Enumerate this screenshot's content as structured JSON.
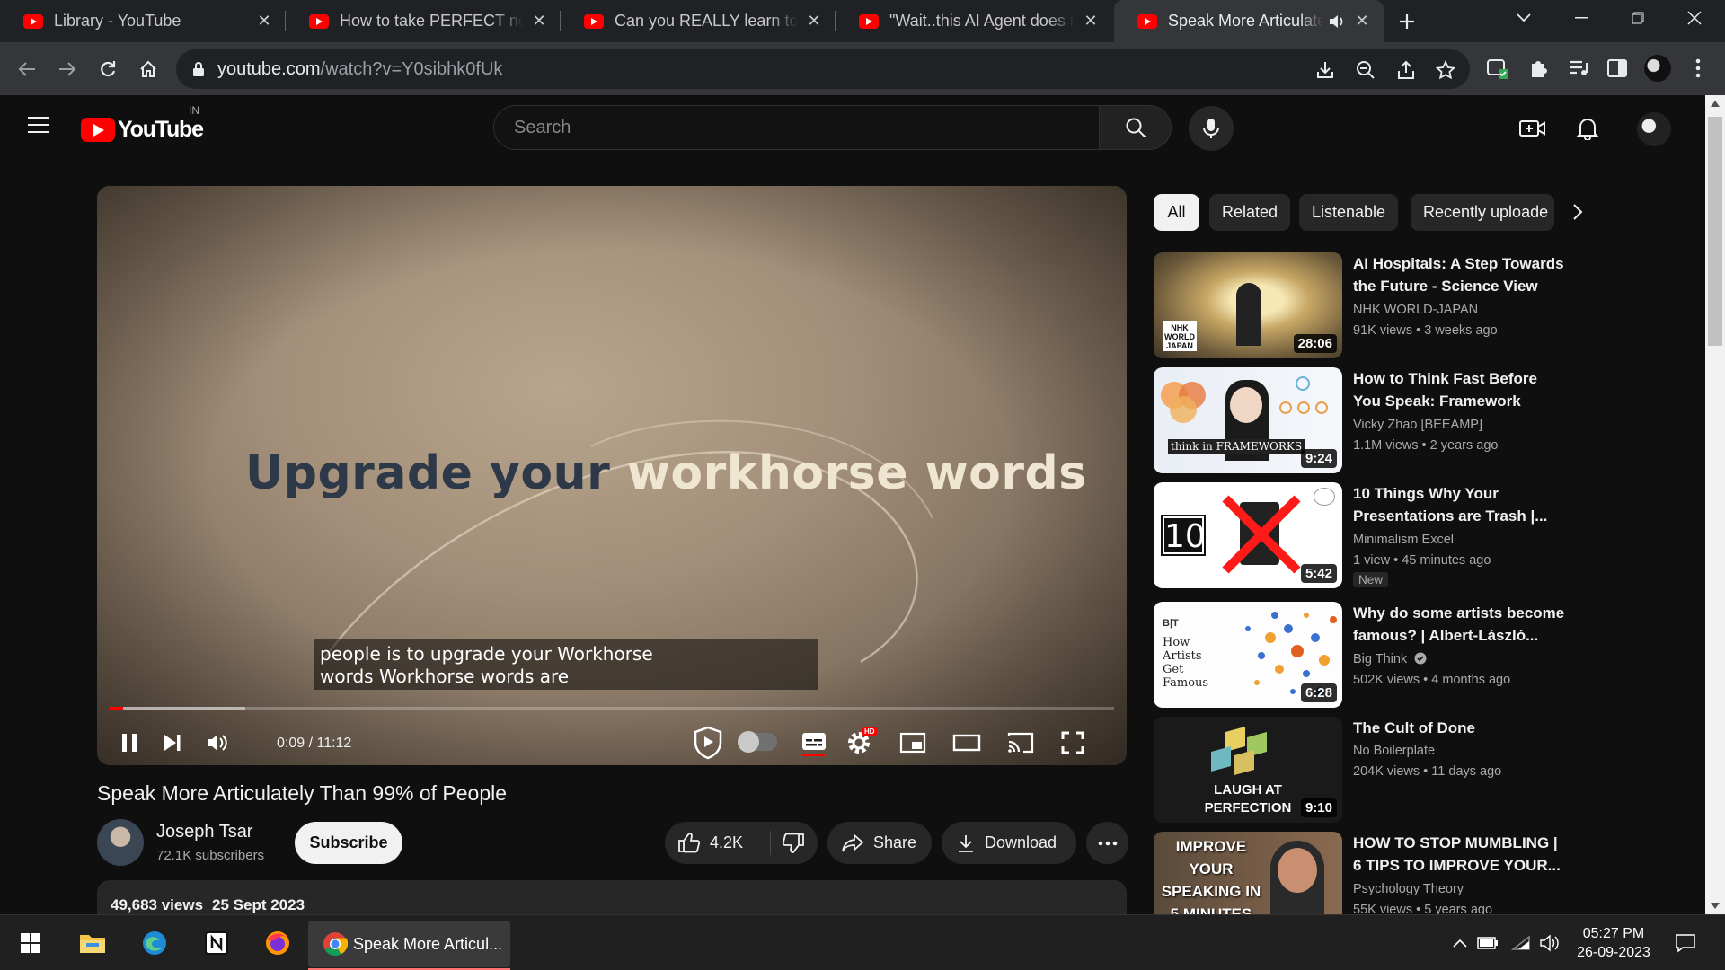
{
  "browser": {
    "tabs": [
      {
        "title": "Library - YouTube",
        "active": false
      },
      {
        "title": "How to take PERFECT notes w",
        "active": false
      },
      {
        "title": "Can you REALLY learn to code",
        "active": false
      },
      {
        "title": "\"Wait..this AI Agent does rese",
        "active": false
      },
      {
        "title": "Speak More Articulately T",
        "active": true
      }
    ],
    "url_host": "youtube.com",
    "url_path": "/watch?v=Y0sibhk0fUk"
  },
  "masthead": {
    "logo_text": "YouTube",
    "country_code": "IN",
    "search_placeholder": "Search"
  },
  "player": {
    "overlay_text_a": "Upgrade your ",
    "overlay_text_b": "workhorse words",
    "caption_line1": "people is to upgrade your Workhorse",
    "caption_line2": "words Workhorse words are",
    "time": "0:09 / 11:12",
    "progress_played_fraction": 0.013,
    "progress_buffered_fraction": 0.135,
    "hd_badge": "HD",
    "subtitles_on": true
  },
  "video": {
    "title": "Speak More Articulately Than 99% of People",
    "channel": "Joseph Tsar",
    "subscribers": "72.1K subscribers",
    "subscribe_label": "Subscribe",
    "likes": "4.2K",
    "share_label": "Share",
    "download_label": "Download",
    "views": "49,683 views",
    "date": "25 Sept 2023"
  },
  "chips": [
    "All",
    "Related",
    "Listenable",
    "Recently uploade"
  ],
  "recommendations": [
    {
      "title": "AI Hospitals: A Step Towards the Future - Science View",
      "channel": "NHK WORLD-JAPAN",
      "views": "91K views",
      "age": "3 weeks ago",
      "duration": "28:06",
      "thumb_text": "NHK WORLD JAPAN",
      "verified": false,
      "badge": ""
    },
    {
      "title": "How to Think Fast Before You Speak: Framework Thinking",
      "channel": "Vicky Zhao [BEEAMP]",
      "views": "1.1M views",
      "age": "2 years ago",
      "duration": "9:24",
      "thumb_text": "think in FRAMEWORKS",
      "verified": false,
      "badge": ""
    },
    {
      "title": "10 Things Why Your Presentations are Trash |...",
      "channel": "Minimalism Excel",
      "views": "1 view",
      "age": "45 minutes ago",
      "duration": "5:42",
      "thumb_text": "10",
      "verified": false,
      "badge": "New"
    },
    {
      "title": "Why do some artists become famous? | Albert-László...",
      "channel": "Big Think",
      "views": "502K views",
      "age": "4 months ago",
      "duration": "6:28",
      "thumb_text": "How Artists Get Famous",
      "verified": true,
      "badge": ""
    },
    {
      "title": "The Cult of Done",
      "channel": "No Boilerplate",
      "views": "204K views",
      "age": "11 days ago",
      "duration": "9:10",
      "thumb_text": "LAUGH AT PERFECTION",
      "verified": false,
      "badge": ""
    },
    {
      "title": "HOW TO STOP MUMBLING | 6 TIPS TO IMPROVE YOUR...",
      "channel": "Psychology Theory",
      "views": "55K views",
      "age": "5 years ago",
      "duration": "",
      "thumb_text": "IMPROVE YOUR SPEAKING IN 5 MINUTES",
      "verified": false,
      "badge": ""
    }
  ],
  "taskbar": {
    "active_window": "Speak More Articul...",
    "time": "05:27 PM",
    "date": "26-09-2023"
  },
  "colors": {
    "youtube_red": "#ff0000",
    "background": "#0f0f0f",
    "chip_bg": "#272727"
  }
}
